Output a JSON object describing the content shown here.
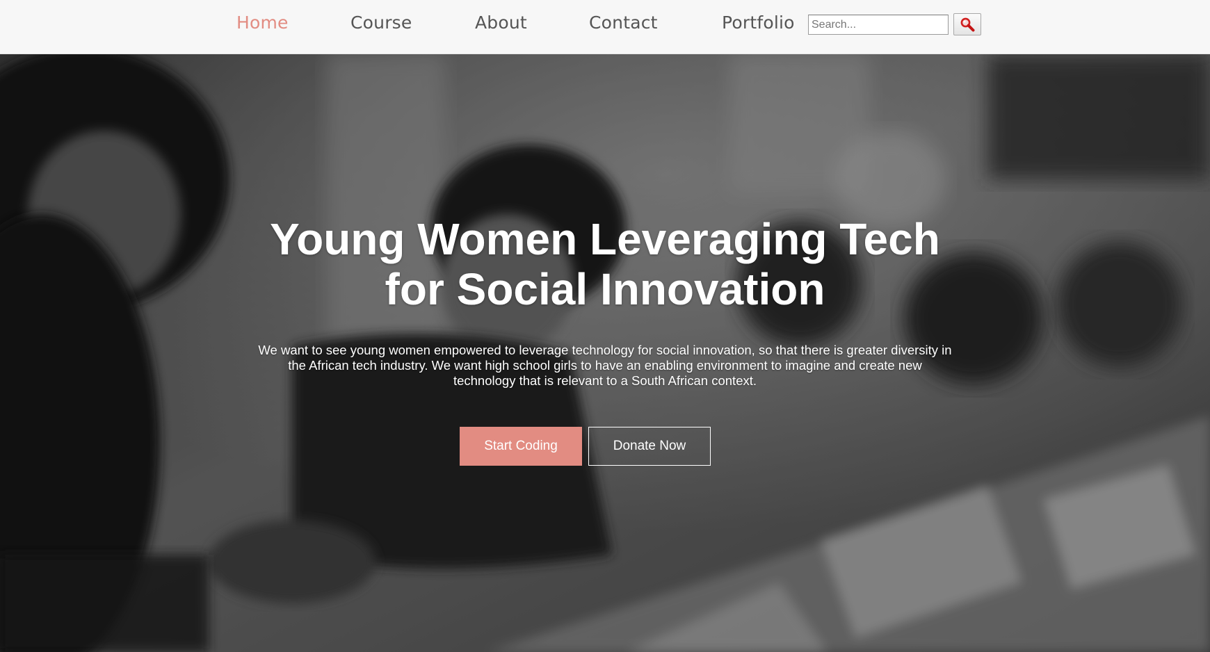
{
  "nav": {
    "items": [
      {
        "label": "Home",
        "active": true
      },
      {
        "label": "Course",
        "active": false
      },
      {
        "label": "About",
        "active": false
      },
      {
        "label": "Contact",
        "active": false
      },
      {
        "label": "Portfolio",
        "active": false
      }
    ],
    "search": {
      "placeholder": "Search...",
      "value": ""
    },
    "search_button_icon": "magnifier-icon"
  },
  "hero": {
    "title_line1": "Young Women Leveraging Tech",
    "title_line2": "for Social Innovation",
    "description": "We want to see young women empowered to leverage technology for social innovation, so that there is greater diversity in the African tech industry. We want high school girls to have an enabling environment to imagine and create new technology that is relevant to a South African context.",
    "primary_button": "Start Coding",
    "secondary_button": "Donate Now",
    "background": "grayscale-photo-young-women-coding-at-laptops"
  },
  "colors": {
    "accent": "#e28c82",
    "nav_bg": "#f7f7f7",
    "nav_text": "#555555",
    "hero_text": "#ffffff"
  }
}
